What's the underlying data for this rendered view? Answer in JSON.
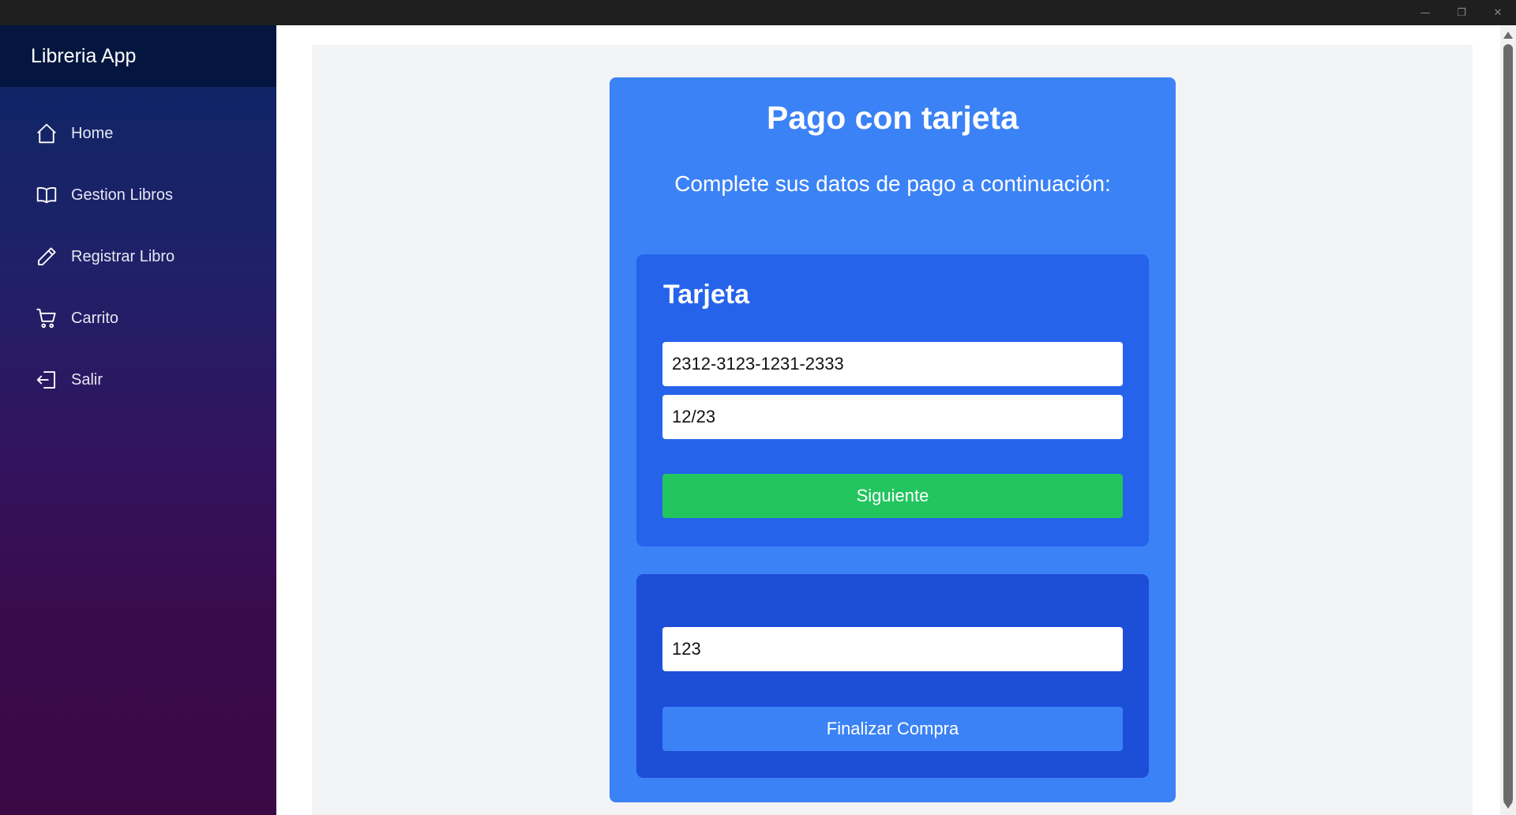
{
  "window": {
    "minimize_glyph": "—",
    "maximize_glyph": "❐",
    "close_glyph": "✕"
  },
  "sidebar": {
    "title": "Libreria App",
    "items": [
      {
        "label": "Home",
        "icon": "home-icon"
      },
      {
        "label": "Gestion Libros",
        "icon": "book-icon"
      },
      {
        "label": "Registrar Libro",
        "icon": "pencil-icon"
      },
      {
        "label": "Carrito",
        "icon": "cart-icon"
      },
      {
        "label": "Salir",
        "icon": "logout-icon"
      }
    ]
  },
  "payment": {
    "title": "Pago con tarjeta",
    "subtitle": "Complete sus datos de pago a continuación:",
    "card_section": {
      "title": "Tarjeta",
      "card_number": "2312-3123-1231-2333",
      "expiry": "12/23",
      "next_label": "Siguiente"
    },
    "cvv_section": {
      "cvv": "123",
      "finish_label": "Finalizar Compra"
    }
  },
  "colors": {
    "sidebar_header": "#04163f",
    "card": "#3b82f6",
    "panel_primary": "#2563eb",
    "panel_secondary": "#1d4ed8",
    "next_button": "#22c55e",
    "finish_button": "#3b82f6"
  }
}
